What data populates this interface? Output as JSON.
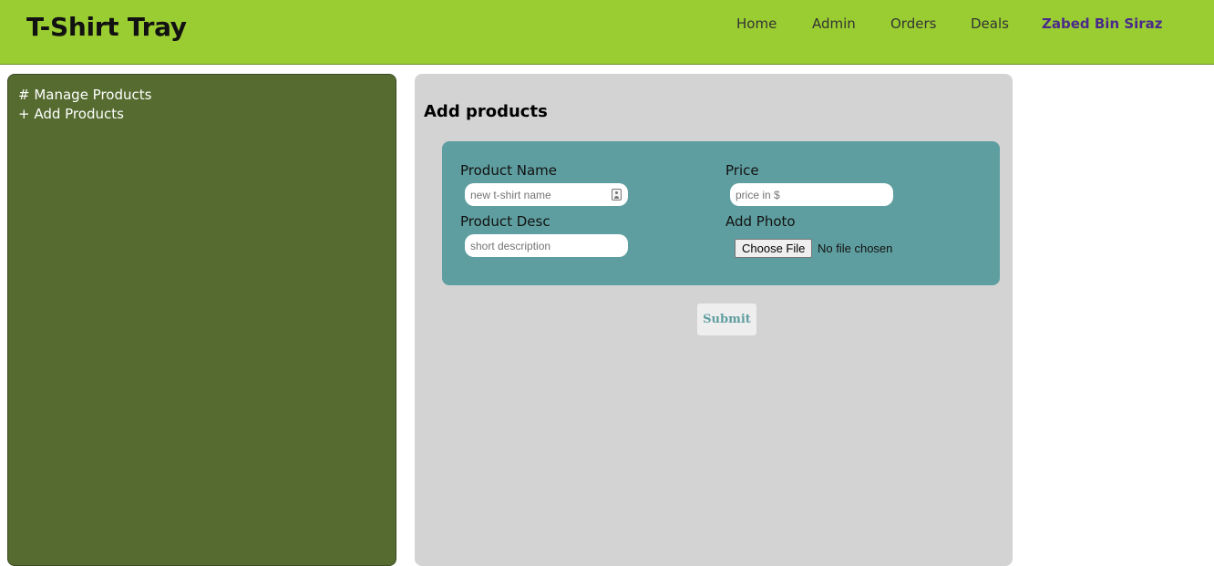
{
  "header": {
    "brand": "T-Shirt Tray",
    "nav": {
      "home": "Home",
      "admin": "Admin",
      "orders": "Orders",
      "deals": "Deals",
      "user": "Zabed Bin Siraz"
    },
    "colors": {
      "bar": "#9acd32",
      "user": "#4b2a8a"
    }
  },
  "sidebar": {
    "items": [
      {
        "label": "# Manage Products"
      },
      {
        "label": "+ Add Products"
      }
    ],
    "color": "#556b2f"
  },
  "main": {
    "title": "Add products",
    "form": {
      "color": "#5f9ea0",
      "product_name": {
        "label": "Product Name",
        "placeholder": "new t-shirt name",
        "value": ""
      },
      "price": {
        "label": "Price",
        "placeholder": "price in $",
        "value": ""
      },
      "product_desc": {
        "label": "Product Desc",
        "placeholder": "short description",
        "value": ""
      },
      "photo": {
        "label": "Add Photo",
        "button": "Choose File",
        "status": "No file chosen"
      }
    },
    "submit_label": "Submit"
  },
  "icons": {
    "autofill": "contact-card-icon"
  }
}
